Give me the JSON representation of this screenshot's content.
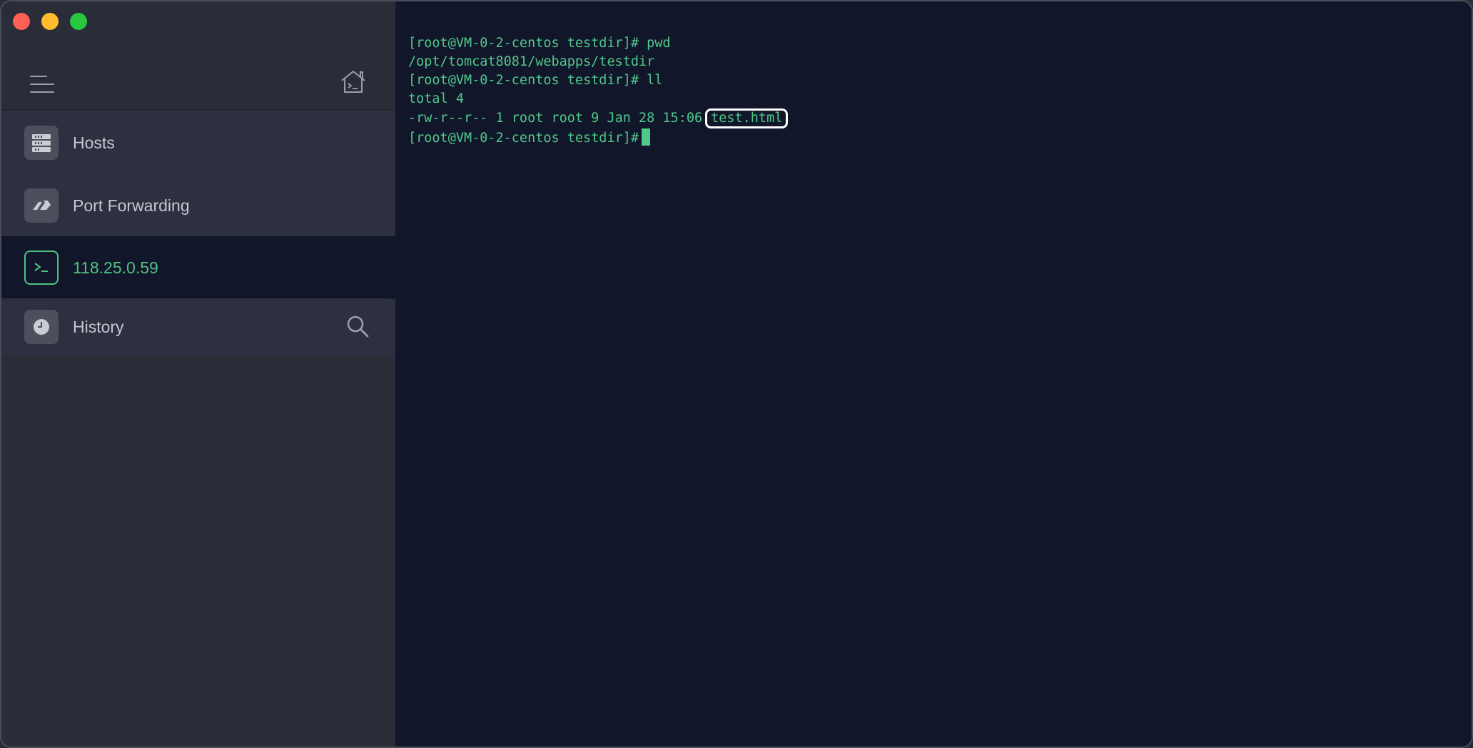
{
  "sidebar": {
    "items": [
      {
        "label": "Hosts",
        "icon": "server-icon"
      },
      {
        "label": "Port Forwarding",
        "icon": "port-forward-icon"
      },
      {
        "label": "118.25.0.59",
        "icon": "terminal-icon",
        "active": true
      },
      {
        "label": "History",
        "icon": "clock-icon"
      }
    ]
  },
  "terminal": {
    "lines": [
      "[root@VM-0-2-centos testdir]# pwd",
      "/opt/tomcat8081/webapps/testdir",
      "[root@VM-0-2-centos testdir]# ll",
      "total 4"
    ],
    "file_line_prefix": "-rw-r--r-- 1 root root 9 Jan 28 15:06",
    "file_name": "test.html",
    "prompt": "[root@VM-0-2-centos testdir]#"
  },
  "colors": {
    "accent": "#4fc282",
    "terminal_bg": "#12162a",
    "sidebar_bg": "#2a2d38",
    "highlight_border": "#ffffff"
  }
}
